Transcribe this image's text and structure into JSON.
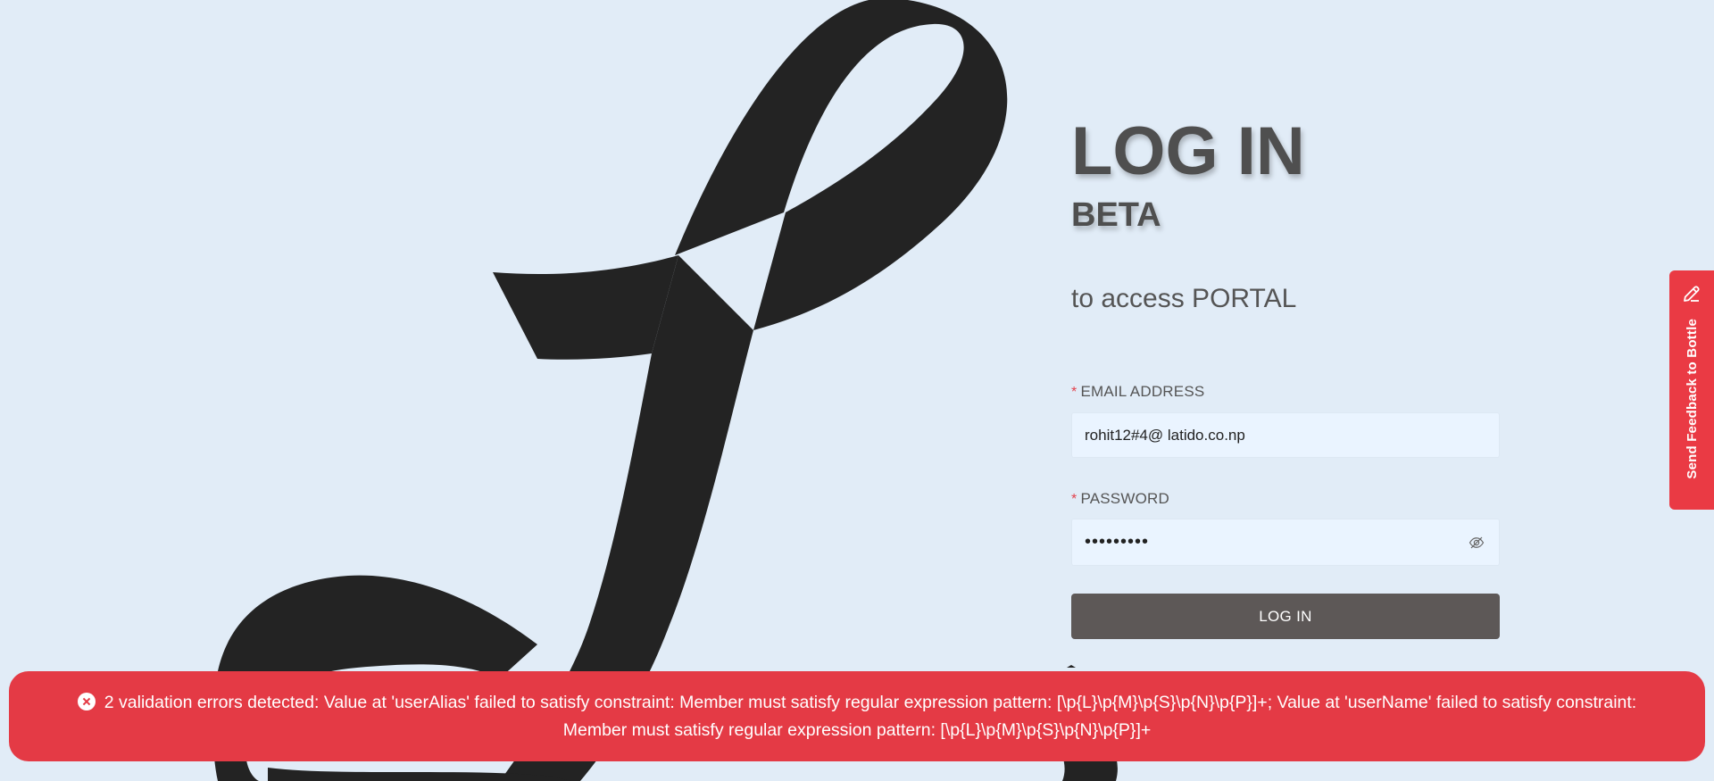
{
  "login": {
    "title": "LOG IN",
    "beta": "BETA",
    "subtitle": "to access PORTAL",
    "email": {
      "required_marker": "*",
      "label": "EMAIL ADDRESS",
      "value": "rohit12#4@ latido.co.np"
    },
    "password": {
      "required_marker": "*",
      "label": "PASSWORD",
      "value": "•••••••••"
    },
    "submit_label": "LOG IN"
  },
  "feedback": {
    "label": "Send Feedback to Bottle",
    "icon": "pencil-icon"
  },
  "error": {
    "icon": "close-circle-icon",
    "message": "2 validation errors detected: Value at 'userAlias' failed to satisfy constraint: Member must satisfy regular expression pattern: [\\p{L}\\p{M}\\p{S}\\p{N}\\p{P}]+; Value at 'userName' failed to satisfy constraint: Member must satisfy regular expression pattern: [\\p{L}\\p{M}\\p{S}\\p{N}\\p{P}]+"
  },
  "colors": {
    "background": "#e1ecf7",
    "logo": "#232323",
    "button": "#5d5857",
    "error": "#e43a45",
    "feedback": "#ea3a44"
  }
}
